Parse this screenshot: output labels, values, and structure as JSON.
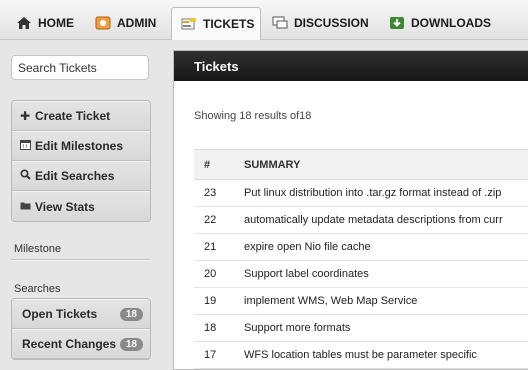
{
  "nav": {
    "tabs": [
      {
        "label": "HOME",
        "icon": "home-icon"
      },
      {
        "label": "ADMIN",
        "icon": "admin-icon"
      },
      {
        "label": "TICKETS",
        "icon": "tickets-icon"
      },
      {
        "label": "DISCUSSION",
        "icon": "discussion-icon"
      },
      {
        "label": "DOWNLOADS",
        "icon": "downloads-icon"
      }
    ],
    "active": "TICKETS"
  },
  "sidebar": {
    "search_value": "Search Tickets",
    "actions": [
      {
        "label": "Create Ticket",
        "icon": "plus-icon"
      },
      {
        "label": "Edit Milestones",
        "icon": "calendar-icon"
      },
      {
        "label": "Edit Searches",
        "icon": "magnifier-icon"
      },
      {
        "label": "View Stats",
        "icon": "folder-icon"
      }
    ],
    "milestone_label": "Milestone",
    "searches_label": "Searches",
    "searches": [
      {
        "label": "Open Tickets",
        "count": "18"
      },
      {
        "label": "Recent Changes",
        "count": "18"
      }
    ]
  },
  "main": {
    "title": "Tickets",
    "results_text": "Showing 18 results of18",
    "columns": [
      "#",
      "SUMMARY"
    ],
    "rows": [
      {
        "num": "23",
        "summary": "Put linux distribution into .tar.gz format instead of .zip"
      },
      {
        "num": "22",
        "summary": "automatically update metadata descriptions from curr"
      },
      {
        "num": "21",
        "summary": "expire open Nio file cache"
      },
      {
        "num": "20",
        "summary": "Support label coordinates"
      },
      {
        "num": "19",
        "summary": "implement WMS, Web Map Service"
      },
      {
        "num": "18",
        "summary": "Support more formats"
      },
      {
        "num": "17",
        "summary": "WFS location tables must be parameter specific"
      }
    ]
  },
  "colors": {
    "header_dark": "#1f1f1f",
    "badge_gray": "#8a8a8a",
    "downloads_green": "#3a8a2e",
    "admin_orange": "#e08a1e"
  }
}
